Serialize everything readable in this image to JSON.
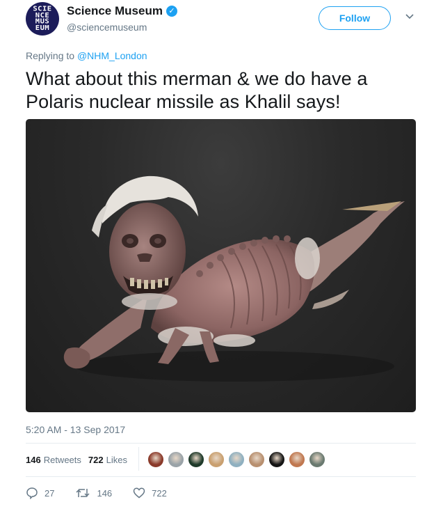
{
  "account": {
    "display_name": "Science Museum",
    "handle": "@sciencemuseum",
    "verified_icon": "verified-badge-icon",
    "avatar_logo_lines": "SCIE\nNCE\nMUS\nEUM"
  },
  "header": {
    "follow_label": "Follow",
    "more_icon": "chevron-down-icon"
  },
  "reply": {
    "prefix": "Replying to ",
    "mention": "@NHM_London"
  },
  "tweet": {
    "text": "What about this merman & we do have a Polaris nuclear missile as Khalil says!",
    "timestamp": "5:20 AM - 13 Sep 2017"
  },
  "stats": {
    "retweets_count": "146",
    "retweets_label": "Retweets",
    "likes_count": "722",
    "likes_label": "Likes"
  },
  "likers": [
    {
      "color": "#8a3a2a"
    },
    {
      "color": "#9aa3a8"
    },
    {
      "color": "#1f3a2a"
    },
    {
      "color": "#c9a070"
    },
    {
      "color": "#8fb0c0"
    },
    {
      "color": "#b89070"
    },
    {
      "color": "#151515"
    },
    {
      "color": "#c07850"
    },
    {
      "color": "#6a7a70"
    }
  ],
  "actions": {
    "reply_count": "27",
    "retweet_count": "146",
    "like_count": "722"
  },
  "colors": {
    "accent": "#1da1f2",
    "secondary_text": "#657786",
    "primary_text": "#14171a"
  }
}
